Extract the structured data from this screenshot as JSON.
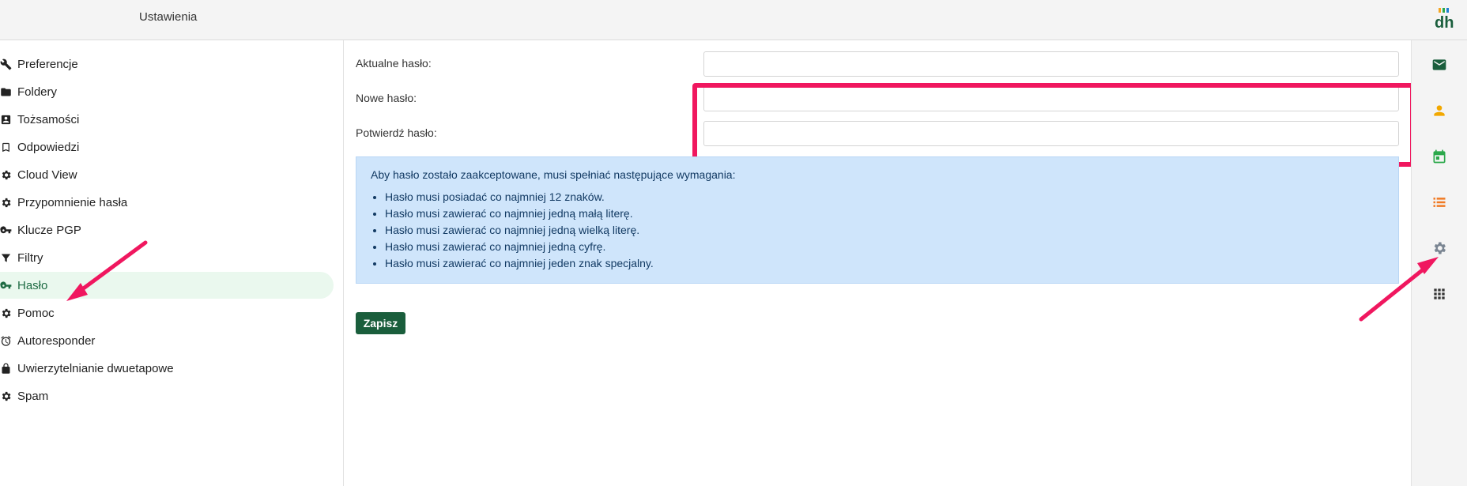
{
  "header": {
    "title": "Ustawienia",
    "logo": "dh-logo"
  },
  "sidebar": {
    "items": [
      {
        "label": "Preferencje",
        "icon": "wrench-icon"
      },
      {
        "label": "Foldery",
        "icon": "folder-icon"
      },
      {
        "label": "Tożsamości",
        "icon": "contact-card-icon"
      },
      {
        "label": "Odpowiedzi",
        "icon": "bookmark-icon"
      },
      {
        "label": "Cloud View",
        "icon": "gear-icon"
      },
      {
        "label": "Przypomnienie hasła",
        "icon": "gear-icon"
      },
      {
        "label": "Klucze PGP",
        "icon": "key-icon"
      },
      {
        "label": "Filtry",
        "icon": "filter-icon"
      },
      {
        "label": "Hasło",
        "icon": "key-icon",
        "active": true
      },
      {
        "label": "Pomoc",
        "icon": "gear-icon"
      },
      {
        "label": "Autoresponder",
        "icon": "alarm-icon"
      },
      {
        "label": "Uwierzytelnianie dwuetapowe",
        "icon": "lock-icon"
      },
      {
        "label": "Spam",
        "icon": "gear-icon"
      }
    ]
  },
  "form": {
    "current_label": "Aktualne hasło:",
    "new_label": "Nowe hasło:",
    "confirm_label": "Potwierdź hasło:",
    "current_value": "",
    "new_value": "",
    "confirm_value": "",
    "requirements_intro": "Aby hasło zostało zaakceptowane, musi spełniać następujące wymagania:",
    "requirements": [
      "Hasło musi posiadać co najmniej 12 znaków.",
      "Hasło musi zawierać co najmniej jedną małą literę.",
      "Hasło musi zawierać co najmniej jedną wielką literę.",
      "Hasło musi zawierać co najmniej jedną cyfrę.",
      "Hasło musi zawierać co najmniej jeden znak specjalny."
    ],
    "save_label": "Zapisz"
  },
  "rightbar": {
    "icons": [
      "mail-icon",
      "contacts-icon",
      "calendar-icon",
      "tasks-icon",
      "settings-icon",
      "apps-grid-icon"
    ]
  },
  "colors": {
    "accent": "#1a5e3c",
    "highlight": "#f0175f",
    "info_bg": "#cfe5fb",
    "active_bg": "#eaf8ee"
  }
}
